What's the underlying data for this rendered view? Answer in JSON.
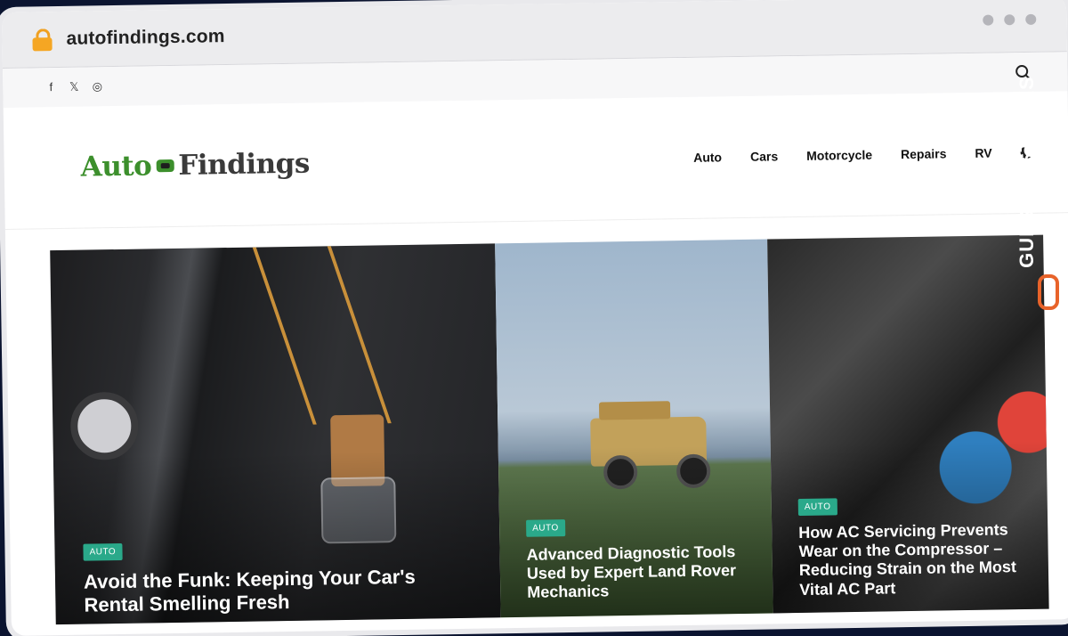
{
  "browser": {
    "url": "autofindings.com"
  },
  "topbar": {
    "social": [
      "f",
      "𝕏",
      "◎"
    ]
  },
  "site": {
    "logo_part1": "Auto",
    "logo_part2": "Findings",
    "nav": [
      "Auto",
      "Cars",
      "Motorcycle",
      "Repairs",
      "RV"
    ]
  },
  "cards": [
    {
      "tag": "AUTO",
      "title": "Avoid the Funk: Keeping Your Car's Rental Smelling Fresh"
    },
    {
      "tag": "AUTO",
      "title": "Advanced Diagnostic Tools Used by Expert Land Rover Mechanics"
    },
    {
      "tag": "AUTO",
      "title": "How AC Servicing Prevents Wear on the Compressor – Reducing Strain on the Most Vital AC Part"
    }
  ],
  "watermark": {
    "text": "GUESTPOSTLINKS"
  },
  "colors": {
    "accent_green": "#3c8f2c",
    "tag_green": "#2aa98a",
    "watermark_orange": "#e8632a"
  }
}
